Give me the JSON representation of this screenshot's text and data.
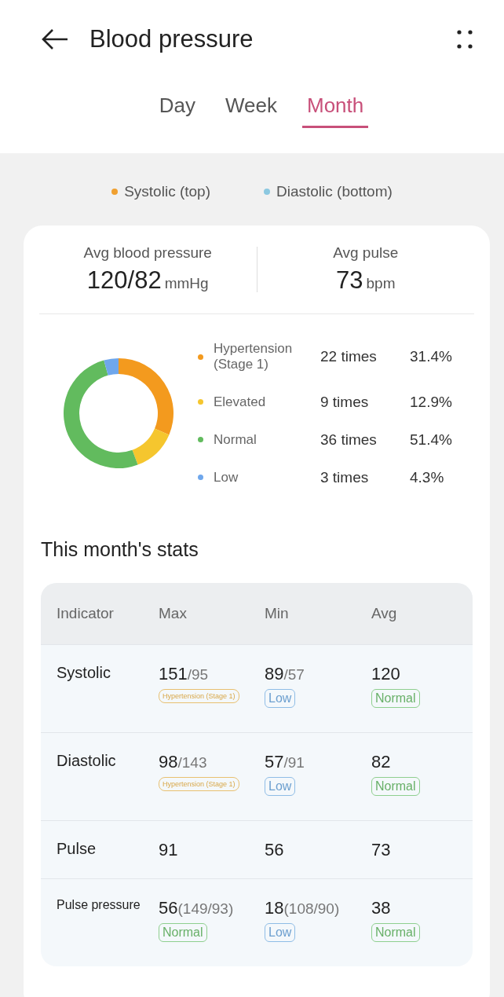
{
  "header": {
    "title": "Blood pressure"
  },
  "tabs": [
    {
      "label": "Day",
      "selected": false
    },
    {
      "label": "Week",
      "selected": false
    },
    {
      "label": "Month",
      "selected": true
    }
  ],
  "series_legend": [
    {
      "label": "Systolic (top)",
      "color": "#f0a030"
    },
    {
      "label": "Diastolic (bottom)",
      "color": "#8cc8e0"
    }
  ],
  "summary": {
    "bp_label": "Avg blood pressure",
    "bp_value": "120/82",
    "bp_unit": "mmHg",
    "pulse_label": "Avg pulse",
    "pulse_value": "73",
    "pulse_unit": "bpm"
  },
  "distribution": {
    "chart_data": {
      "type": "donut",
      "values": [
        31.4,
        12.9,
        51.4,
        4.3
      ]
    },
    "items": [
      {
        "label": "Hypertension (Stage 1)",
        "count": "22 times",
        "percent": "31.4%",
        "color": "#f39a1e"
      },
      {
        "label": "Elevated",
        "count": "9 times",
        "percent": "12.9%",
        "color": "#f5c62e"
      },
      {
        "label": "Normal",
        "count": "36 times",
        "percent": "51.4%",
        "color": "#62bb5e"
      },
      {
        "label": "Low",
        "count": "3 times",
        "percent": "4.3%",
        "color": "#6fa7ec"
      }
    ]
  },
  "stats": {
    "title": "This month's stats",
    "columns": [
      "Indicator",
      "Max",
      "Min",
      "Avg"
    ],
    "rows": [
      {
        "small": false,
        "cells": [
          {
            "value": "Systolic",
            "kind": "label"
          },
          {
            "value": "151",
            "extra": "/95",
            "tag": {
              "kind": "hypertension",
              "text": "Hypertension (Stage 1)"
            }
          },
          {
            "value": "89",
            "extra": "/57",
            "tag": {
              "kind": "low",
              "text": "Low"
            }
          },
          {
            "value": "120",
            "tag": {
              "kind": "normal",
              "text": "Normal"
            }
          }
        ]
      },
      {
        "small": false,
        "cells": [
          {
            "value": "Diastolic",
            "kind": "label"
          },
          {
            "value": "98",
            "extra": "/143",
            "tag": {
              "kind": "hypertension",
              "text": "Hypertension (Stage 1)"
            }
          },
          {
            "value": "57",
            "extra": "/91",
            "tag": {
              "kind": "low",
              "text": "Low"
            }
          },
          {
            "value": "82",
            "tag": {
              "kind": "normal",
              "text": "Normal"
            }
          }
        ]
      },
      {
        "small": false,
        "cells": [
          {
            "value": "Pulse",
            "kind": "label"
          },
          {
            "value": "91"
          },
          {
            "value": "56"
          },
          {
            "value": "73"
          }
        ]
      },
      {
        "small": true,
        "cells": [
          {
            "value": "Pulse pressure",
            "kind": "label"
          },
          {
            "value": "56",
            "extra": "(149/93)",
            "tag": {
              "kind": "normal",
              "text": "Normal"
            }
          },
          {
            "value": "18",
            "extra": "(108/90)",
            "tag": {
              "kind": "low",
              "text": "Low"
            }
          },
          {
            "value": "38",
            "tag": {
              "kind": "normal",
              "text": "Normal"
            }
          }
        ]
      }
    ]
  }
}
